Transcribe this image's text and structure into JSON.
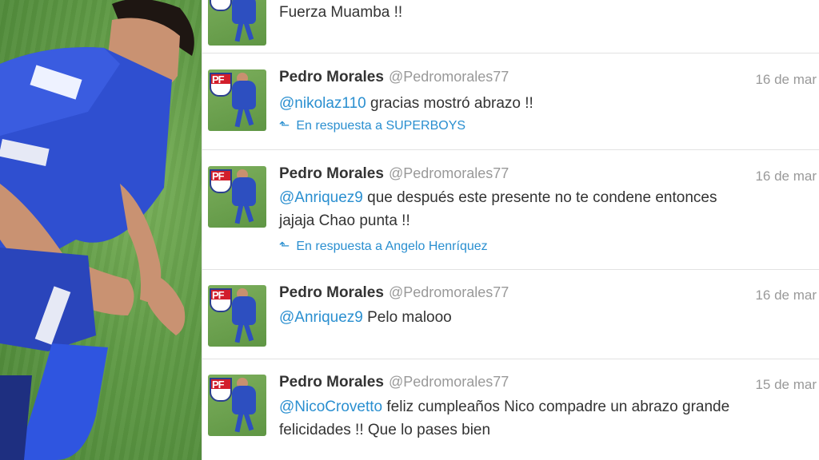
{
  "tweets": [
    {
      "text_rest": "Fuerza Muamba !!"
    },
    {
      "name": "Pedro Morales",
      "handle": "@Pedromorales77",
      "date": "16 de mar",
      "mention": "@nikolaz110",
      "text_rest": " gracias mostró abrazo !!",
      "reply_label": "En respuesta a SUPERBOYS"
    },
    {
      "name": "Pedro Morales",
      "handle": "@Pedromorales77",
      "date": "16 de mar",
      "mention": "@Anriquez9",
      "text_rest": " que después este presente no te condene entonces",
      "text_line2": "jajaja Chao punta !!",
      "reply_label": "En respuesta a Angelo Henríquez"
    },
    {
      "name": "Pedro Morales",
      "handle": "@Pedromorales77",
      "date": "16 de mar",
      "mention": "@Anriquez9",
      "text_rest": " Pelo malooo"
    },
    {
      "name": "Pedro Morales",
      "handle": "@Pedromorales77",
      "date": "15 de mar",
      "mention": "@NicoCrovetto",
      "text_rest": " feliz cumpleaños Nico compadre un abrazo grande",
      "text_line2": "felicidades !! Que lo pases bien"
    }
  ],
  "icons": {
    "reply": "reply-arrow-icon"
  },
  "colors": {
    "link": "#2a8fd0",
    "muted": "#999999",
    "text": "#333333"
  }
}
